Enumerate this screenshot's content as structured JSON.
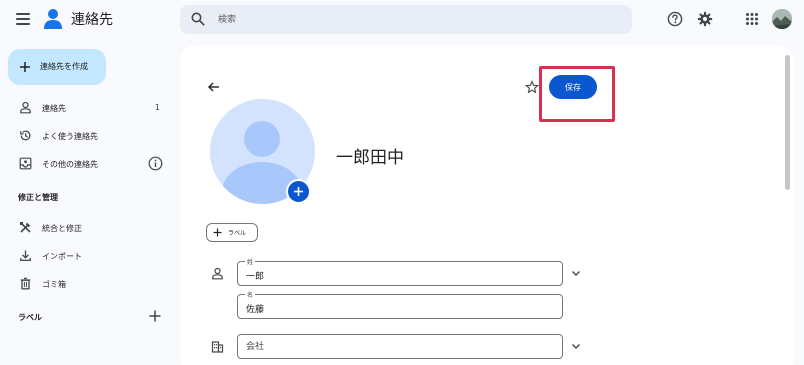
{
  "header": {
    "app_title": "連絡先",
    "search_placeholder": "検索",
    "icons": [
      "menu-icon",
      "contacts-logo-icon",
      "search-icon",
      "help-icon",
      "gear-icon",
      "apps-grid-icon",
      "account-avatar"
    ]
  },
  "sidebar": {
    "create_label": "連絡先を作成",
    "items": [
      {
        "label": "連絡先",
        "count": "1",
        "icon": "person-icon"
      },
      {
        "label": "よく使う連絡先",
        "icon": "history-icon"
      },
      {
        "label": "その他の連絡先",
        "icon": "inbox-person-icon"
      }
    ],
    "section_manage": "修正と管理",
    "manage_items": [
      {
        "label": "統合と修正",
        "icon": "tools-icon"
      },
      {
        "label": "インポート",
        "icon": "download-icon"
      },
      {
        "label": "ゴミ箱",
        "icon": "trash-icon"
      }
    ],
    "section_labels": "ラベル"
  },
  "editor": {
    "save_label": "保存",
    "contact_name": "一郎田中",
    "label_chip": "ラベル",
    "fields": {
      "last_name_label": "姓",
      "last_name_value": "一郎",
      "first_name_label": "名",
      "first_name_value": "佐藤",
      "company_placeholder": "会社"
    }
  },
  "colors": {
    "accent": "#0b57d0",
    "create_button_bg": "#c2e7ff",
    "highlight": "#d9304f",
    "photo_bg": "#d3e3fd"
  }
}
